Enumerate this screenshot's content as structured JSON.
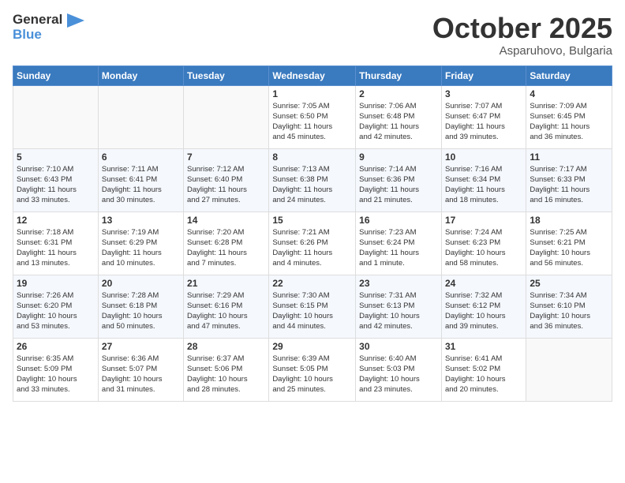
{
  "header": {
    "logo_general": "General",
    "logo_blue": "Blue",
    "month": "October 2025",
    "location": "Asparuhovo, Bulgaria"
  },
  "weekdays": [
    "Sunday",
    "Monday",
    "Tuesday",
    "Wednesday",
    "Thursday",
    "Friday",
    "Saturday"
  ],
  "weeks": [
    [
      {
        "day": "",
        "info": ""
      },
      {
        "day": "",
        "info": ""
      },
      {
        "day": "",
        "info": ""
      },
      {
        "day": "1",
        "info": "Sunrise: 7:05 AM\nSunset: 6:50 PM\nDaylight: 11 hours\nand 45 minutes."
      },
      {
        "day": "2",
        "info": "Sunrise: 7:06 AM\nSunset: 6:48 PM\nDaylight: 11 hours\nand 42 minutes."
      },
      {
        "day": "3",
        "info": "Sunrise: 7:07 AM\nSunset: 6:47 PM\nDaylight: 11 hours\nand 39 minutes."
      },
      {
        "day": "4",
        "info": "Sunrise: 7:09 AM\nSunset: 6:45 PM\nDaylight: 11 hours\nand 36 minutes."
      }
    ],
    [
      {
        "day": "5",
        "info": "Sunrise: 7:10 AM\nSunset: 6:43 PM\nDaylight: 11 hours\nand 33 minutes."
      },
      {
        "day": "6",
        "info": "Sunrise: 7:11 AM\nSunset: 6:41 PM\nDaylight: 11 hours\nand 30 minutes."
      },
      {
        "day": "7",
        "info": "Sunrise: 7:12 AM\nSunset: 6:40 PM\nDaylight: 11 hours\nand 27 minutes."
      },
      {
        "day": "8",
        "info": "Sunrise: 7:13 AM\nSunset: 6:38 PM\nDaylight: 11 hours\nand 24 minutes."
      },
      {
        "day": "9",
        "info": "Sunrise: 7:14 AM\nSunset: 6:36 PM\nDaylight: 11 hours\nand 21 minutes."
      },
      {
        "day": "10",
        "info": "Sunrise: 7:16 AM\nSunset: 6:34 PM\nDaylight: 11 hours\nand 18 minutes."
      },
      {
        "day": "11",
        "info": "Sunrise: 7:17 AM\nSunset: 6:33 PM\nDaylight: 11 hours\nand 16 minutes."
      }
    ],
    [
      {
        "day": "12",
        "info": "Sunrise: 7:18 AM\nSunset: 6:31 PM\nDaylight: 11 hours\nand 13 minutes."
      },
      {
        "day": "13",
        "info": "Sunrise: 7:19 AM\nSunset: 6:29 PM\nDaylight: 11 hours\nand 10 minutes."
      },
      {
        "day": "14",
        "info": "Sunrise: 7:20 AM\nSunset: 6:28 PM\nDaylight: 11 hours\nand 7 minutes."
      },
      {
        "day": "15",
        "info": "Sunrise: 7:21 AM\nSunset: 6:26 PM\nDaylight: 11 hours\nand 4 minutes."
      },
      {
        "day": "16",
        "info": "Sunrise: 7:23 AM\nSunset: 6:24 PM\nDaylight: 11 hours\nand 1 minute."
      },
      {
        "day": "17",
        "info": "Sunrise: 7:24 AM\nSunset: 6:23 PM\nDaylight: 10 hours\nand 58 minutes."
      },
      {
        "day": "18",
        "info": "Sunrise: 7:25 AM\nSunset: 6:21 PM\nDaylight: 10 hours\nand 56 minutes."
      }
    ],
    [
      {
        "day": "19",
        "info": "Sunrise: 7:26 AM\nSunset: 6:20 PM\nDaylight: 10 hours\nand 53 minutes."
      },
      {
        "day": "20",
        "info": "Sunrise: 7:28 AM\nSunset: 6:18 PM\nDaylight: 10 hours\nand 50 minutes."
      },
      {
        "day": "21",
        "info": "Sunrise: 7:29 AM\nSunset: 6:16 PM\nDaylight: 10 hours\nand 47 minutes."
      },
      {
        "day": "22",
        "info": "Sunrise: 7:30 AM\nSunset: 6:15 PM\nDaylight: 10 hours\nand 44 minutes."
      },
      {
        "day": "23",
        "info": "Sunrise: 7:31 AM\nSunset: 6:13 PM\nDaylight: 10 hours\nand 42 minutes."
      },
      {
        "day": "24",
        "info": "Sunrise: 7:32 AM\nSunset: 6:12 PM\nDaylight: 10 hours\nand 39 minutes."
      },
      {
        "day": "25",
        "info": "Sunrise: 7:34 AM\nSunset: 6:10 PM\nDaylight: 10 hours\nand 36 minutes."
      }
    ],
    [
      {
        "day": "26",
        "info": "Sunrise: 6:35 AM\nSunset: 5:09 PM\nDaylight: 10 hours\nand 33 minutes."
      },
      {
        "day": "27",
        "info": "Sunrise: 6:36 AM\nSunset: 5:07 PM\nDaylight: 10 hours\nand 31 minutes."
      },
      {
        "day": "28",
        "info": "Sunrise: 6:37 AM\nSunset: 5:06 PM\nDaylight: 10 hours\nand 28 minutes."
      },
      {
        "day": "29",
        "info": "Sunrise: 6:39 AM\nSunset: 5:05 PM\nDaylight: 10 hours\nand 25 minutes."
      },
      {
        "day": "30",
        "info": "Sunrise: 6:40 AM\nSunset: 5:03 PM\nDaylight: 10 hours\nand 23 minutes."
      },
      {
        "day": "31",
        "info": "Sunrise: 6:41 AM\nSunset: 5:02 PM\nDaylight: 10 hours\nand 20 minutes."
      },
      {
        "day": "",
        "info": ""
      }
    ]
  ]
}
